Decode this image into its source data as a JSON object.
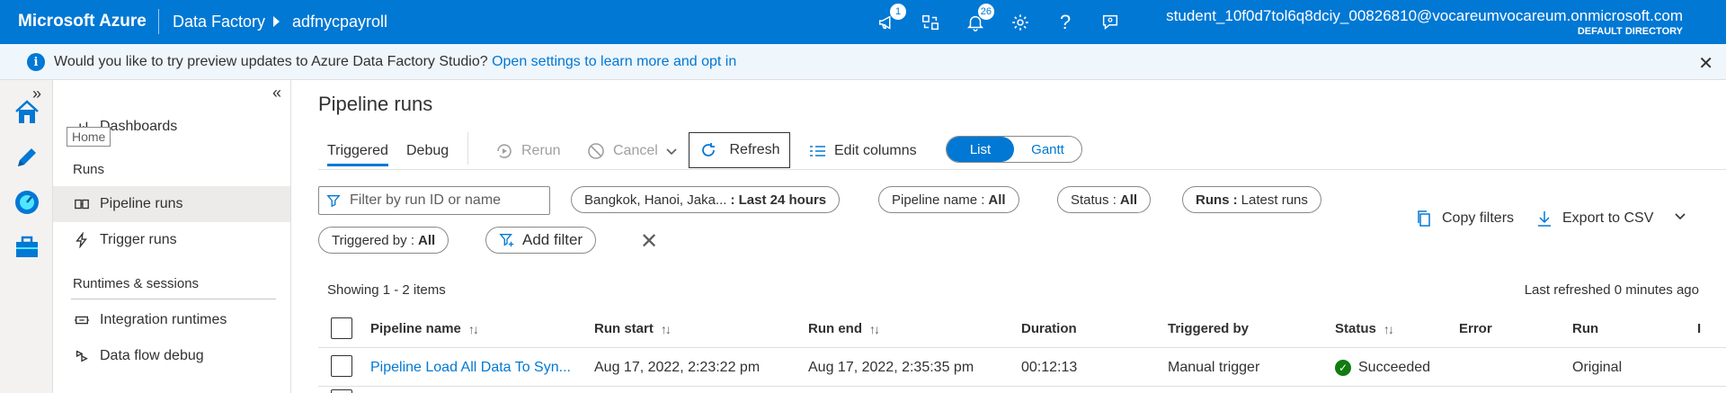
{
  "topbar": {
    "brand": "Microsoft Azure",
    "crumb_service": "Data Factory",
    "crumb_factory": "adfnycpayroll",
    "notifications_badge_1": "1",
    "notifications_badge_2": "26",
    "user_name": "student_10f0d7tol6q8dciy_00826810@vocareumvocareum.onmicrosoft.com",
    "user_directory": "DEFAULT DIRECTORY",
    "bar_color": "#0078d4"
  },
  "banner": {
    "message": "Would you like to try preview updates to Azure Data Factory Studio?",
    "link": "Open settings to learn more and opt in"
  },
  "rail": {
    "items": [
      "home-icon",
      "pencil-icon",
      "monitor-gauge-icon",
      "toolbox-icon"
    ],
    "tooltip": "Home"
  },
  "sidepanel": {
    "dashboards": "Dashboards",
    "runs_header": "Runs",
    "pipeline_runs": "Pipeline runs",
    "trigger_runs": "Trigger runs",
    "runtimes_header": "Runtimes & sessions",
    "integration_runtimes": "Integration runtimes",
    "data_flow_debug": "Data flow debug"
  },
  "main": {
    "title": "Pipeline runs",
    "tabs": {
      "triggered": "Triggered",
      "debug": "Debug"
    },
    "toolbar": {
      "rerun": "Rerun",
      "cancel": "Cancel",
      "refresh": "Refresh",
      "edit_columns": "Edit columns",
      "view_list": "List",
      "view_gantt": "Gantt"
    },
    "filters": {
      "search_placeholder": "Filter by run ID or name",
      "timezone_label": "Bangkok, Hanoi, Jaka...",
      "timezone_value": ": Last 24 hours",
      "pipeline_label": "Pipeline name :",
      "pipeline_value": "All",
      "status_label": "Status :",
      "status_value": "All",
      "runs_label": "Runs :",
      "runs_value": "Latest runs",
      "triggered_label": "Triggered by :",
      "triggered_value": "All",
      "add_filter": "Add filter",
      "copy_filters": "Copy filters",
      "export_csv": "Export to CSV"
    },
    "showing": "Showing 1 - 2 items",
    "last_refreshed": "Last refreshed 0 minutes ago",
    "table": {
      "columns": {
        "pipeline_name": "Pipeline name",
        "run_start": "Run start",
        "run_end": "Run end",
        "duration": "Duration",
        "triggered_by": "Triggered by",
        "status": "Status",
        "error": "Error",
        "run": "Run",
        "extra": "I"
      },
      "rows": [
        {
          "pipeline_name": "Pipeline Load All Data To Syn...",
          "run_start": "Aug 17, 2022, 2:23:22 pm",
          "run_end": "Aug 17, 2022, 2:35:35 pm",
          "duration": "00:12:13",
          "triggered_by": "Manual trigger",
          "status": "Succeeded",
          "error": "",
          "run": "Original"
        }
      ]
    }
  }
}
